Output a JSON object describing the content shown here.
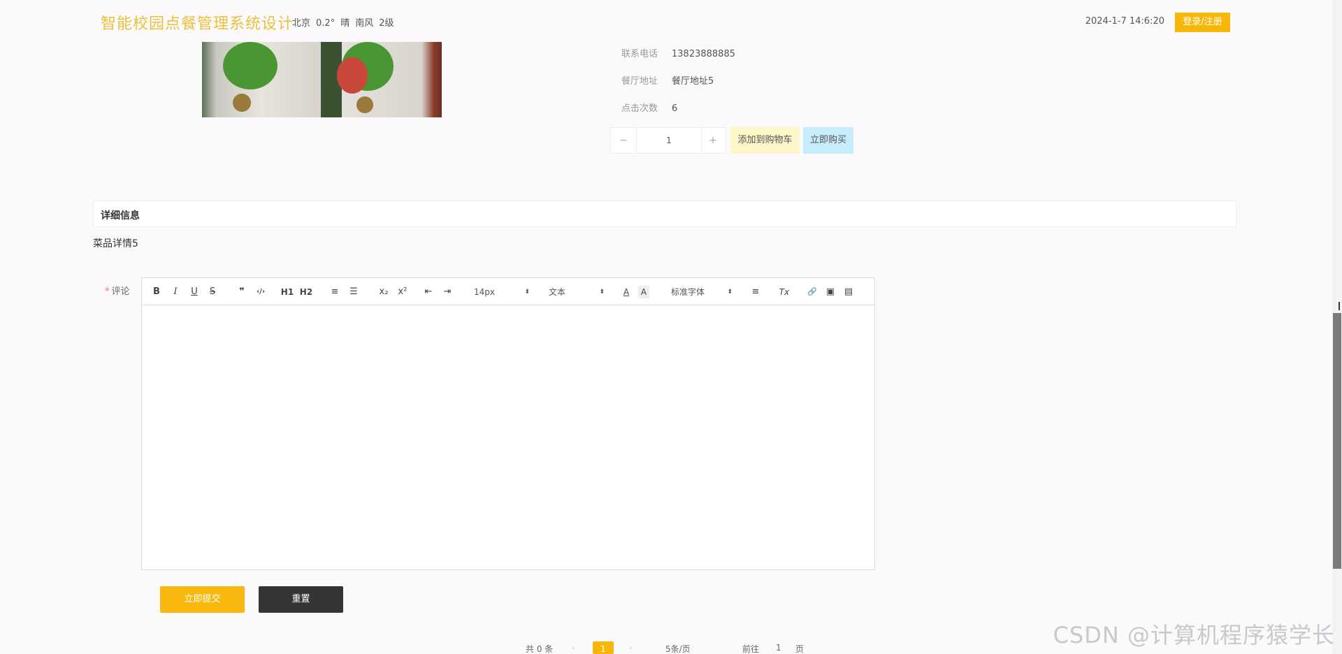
{
  "header": {
    "site_title": "智能校园点餐管理系统设计",
    "weather": {
      "city": "北京",
      "temp": "0.2°",
      "condition": "晴",
      "wind": "南风",
      "level": "2级"
    },
    "datetime": "2024-1-7 14:6:20",
    "login_label": "登录/注册"
  },
  "info": [
    {
      "label": "联系电话",
      "value": "13823888885"
    },
    {
      "label": "餐厅地址",
      "value": "餐厅地址5"
    },
    {
      "label": "点击次数",
      "value": "6"
    }
  ],
  "quantity": {
    "minus": "−",
    "value": "1",
    "plus": "+"
  },
  "actions": {
    "add_to_cart": "添加到购物车",
    "buy_now": "立即购买"
  },
  "detail": {
    "title": "详细信息",
    "content": "菜品详情5"
  },
  "comment": {
    "required_mark": "*",
    "label": "评论",
    "toolbar": {
      "bold": "B",
      "italic": "I",
      "underline": "U",
      "strike": "S",
      "quote": "❞",
      "code": "‹/›",
      "h1": "H1",
      "h2": "H2",
      "ordered_list": "≡",
      "bullet_list": "☰",
      "subscript": "x₂",
      "superscript": "x²",
      "outdent": "⇤",
      "indent": "⇥",
      "font_size": "14px",
      "text_type": "文本",
      "font_family": "标准字体",
      "font_color": "A",
      "bg_color": "A",
      "align": "≡",
      "clear": "Tx",
      "link": "🔗",
      "image": "▣",
      "video": "▤"
    },
    "submit_label": "立即提交",
    "reset_label": "重置"
  },
  "pagination": {
    "total": "共 0 条",
    "prev": "‹",
    "current": "1",
    "next": "›",
    "page_size": "5条/页",
    "goto_label": "前往",
    "goto_value": "1",
    "page_unit": "页"
  },
  "watermark": "CSDN @计算机程序猿学长"
}
